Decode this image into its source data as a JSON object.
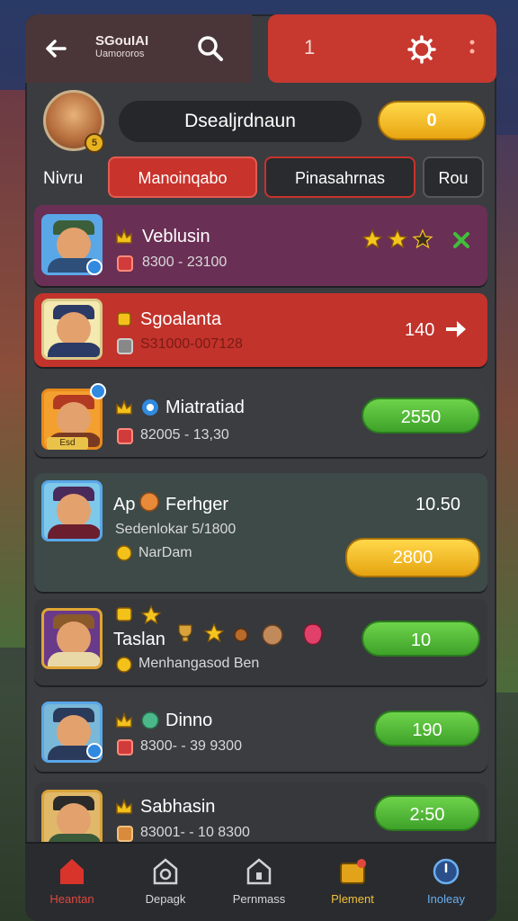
{
  "header": {
    "title_main": "SGouIAI",
    "title_sub": "Uamororos",
    "count": "1"
  },
  "profile": {
    "name": "Dsealjrdnaun",
    "badge": "5",
    "coins": "0"
  },
  "tabs": {
    "label": "Nivru",
    "items": [
      {
        "label": "Manoinqabo"
      },
      {
        "label": "Pinasahrnas"
      },
      {
        "label": "Rou"
      }
    ]
  },
  "rows": [
    {
      "name": "Veblusin",
      "sub": "8300 - 23100"
    },
    {
      "name": "Sgoalanta",
      "sub": "S31000-007128",
      "value": "140"
    },
    {
      "name": "Miatratiad",
      "sub": "82005 - 13,30",
      "button": "2550",
      "pic_label": "Esd"
    },
    {
      "prefix": "Ap",
      "name": "Ferhger",
      "sub": "Sedenlokar 5/1800",
      "sub2": "NarDam",
      "value": "10.50",
      "button": "2800"
    },
    {
      "name": "Taslan",
      "sub": "Menhangasod Ben",
      "button": "10"
    },
    {
      "name": "Dinno",
      "sub": "8300- - 39 9300",
      "button": "190"
    },
    {
      "name": "Sabhasin",
      "sub": "83001- - 10 8300",
      "button": "2:50"
    }
  ],
  "nav": [
    {
      "label": "Heantan",
      "icon": "home-icon"
    },
    {
      "label": "Depagk",
      "icon": "deck-icon"
    },
    {
      "label": "Pernmass",
      "icon": "house-icon"
    },
    {
      "label": "Plement",
      "icon": "chest-icon"
    },
    {
      "label": "Inoleay",
      "icon": "clock-icon"
    }
  ],
  "colors": {
    "accent_red": "#c8332c",
    "accent_gold": "#e8a511",
    "accent_green": "#3ea22a",
    "panel": "#3a3c40"
  }
}
